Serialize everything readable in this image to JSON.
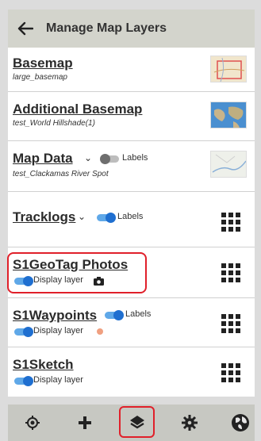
{
  "header": {
    "title": "Manage Map Layers"
  },
  "layers": [
    {
      "name": "Basemap",
      "subtitle": "large_basemap"
    },
    {
      "name": "Additional Basemap",
      "subtitle": "test_World Hillshade(1)"
    },
    {
      "name": "Map Data",
      "subtitle": "test_Clackamas River Spot",
      "toggle_label": "Labels",
      "toggle_on": false
    },
    {
      "name": "Tracklogs",
      "toggle_label": "Labels",
      "toggle_on": true
    },
    {
      "name": "S1GeoTag Photos",
      "display_label": "Display layer",
      "toggle_on": true
    },
    {
      "name": "S1Waypoints",
      "toggle_label": "Labels",
      "display_label": "Display layer",
      "toggle_on": true
    },
    {
      "name": "S1Sketch",
      "display_label": "Display layer",
      "toggle_on": true
    }
  ],
  "bottom_nav": [
    "locate-icon",
    "add-icon",
    "layers-icon",
    "settings-icon",
    "globe-icon"
  ],
  "colors": {
    "accent_blue": "#1f6fd0",
    "highlight_red": "#e0202a",
    "waypoint_dot": "#f0a080"
  }
}
